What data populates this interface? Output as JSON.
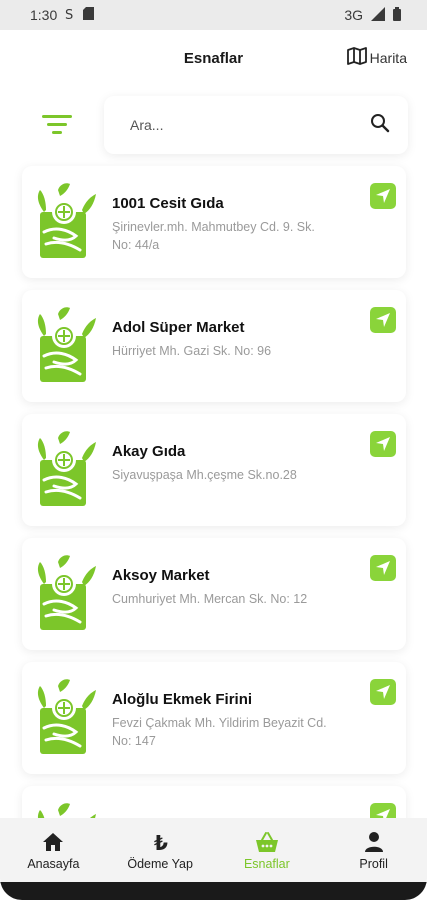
{
  "status_bar": {
    "time": "1:30",
    "network": "3G"
  },
  "header": {
    "title": "Esnaflar",
    "map_label": "Harita"
  },
  "search": {
    "placeholder": "Ara..."
  },
  "colors": {
    "accent": "#7cc62a",
    "nav_button": "#8ad43a"
  },
  "shops": [
    {
      "name": "1001 Cesit Gıda",
      "address": "Şirinevler.mh. Mahmutbey Cd. 9. Sk. No: 44/a"
    },
    {
      "name": "Adol Süper Market",
      "address": "Hürriyet Mh. Gazi Sk. No: 96"
    },
    {
      "name": "Akay Gıda",
      "address": "Siyavuşpaşa Mh.çeşme Sk.no.28"
    },
    {
      "name": "Aksoy Market",
      "address": "Cumhuriyet Mh. Mercan Sk. No: 12"
    },
    {
      "name": "Aloğlu Ekmek Firini",
      "address": "Fevzi Çakmak Mh. Yildirim Beyazit Cd. No: 147"
    },
    {
      "name": "",
      "address": ""
    }
  ],
  "bottom_nav": {
    "items": [
      {
        "label": "Anasayfa",
        "icon": "home-icon"
      },
      {
        "label": "Ödeme Yap",
        "icon": "lira-icon"
      },
      {
        "label": "Esnaflar",
        "icon": "basket-icon",
        "active": true
      },
      {
        "label": "Profil",
        "icon": "user-icon"
      }
    ]
  }
}
